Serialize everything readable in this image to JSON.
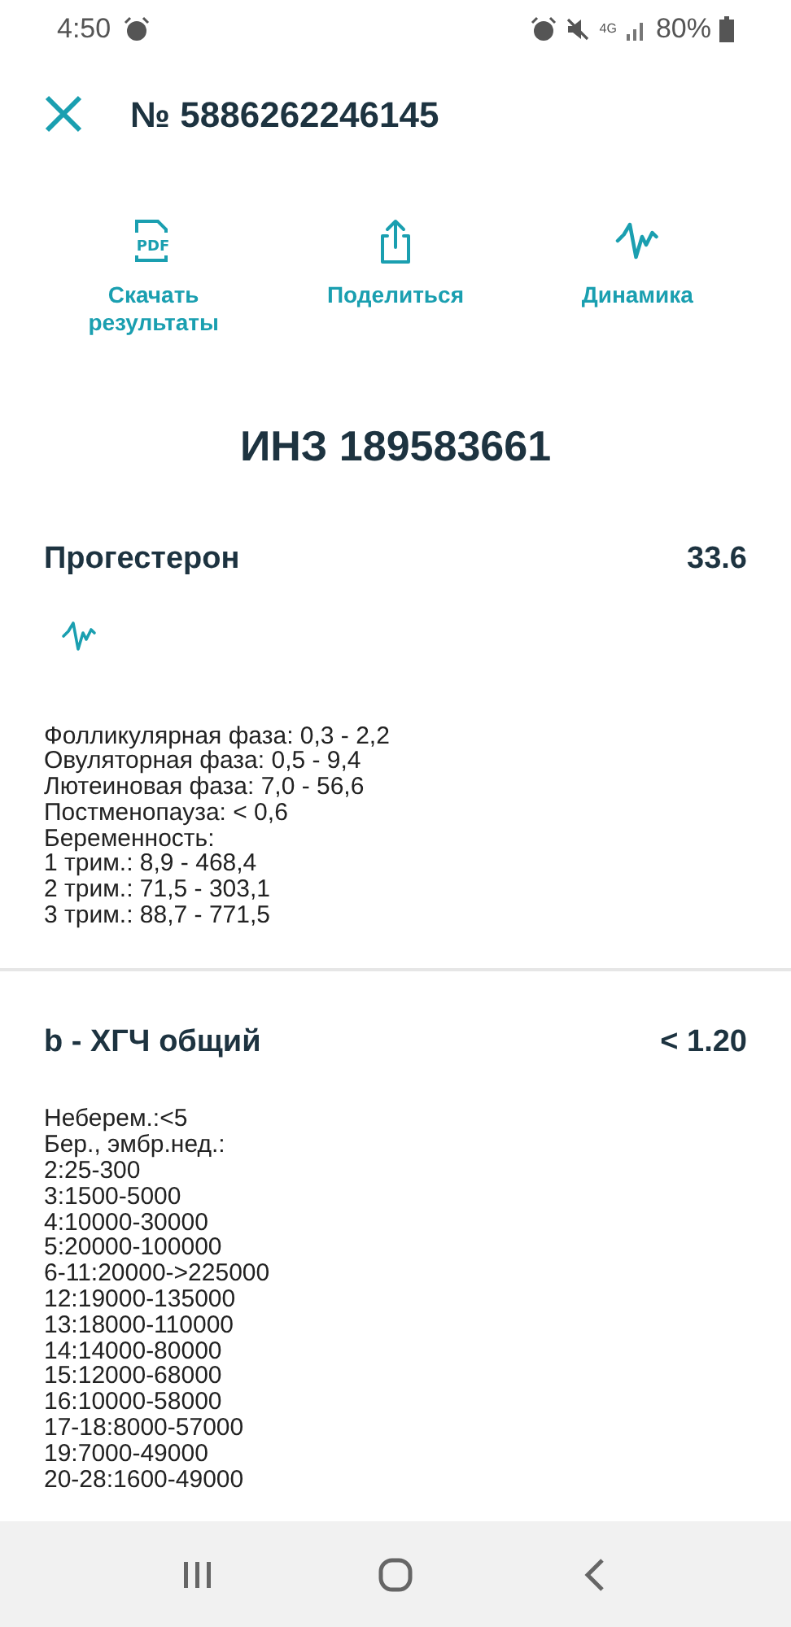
{
  "status_bar": {
    "time": "4:50",
    "network": "4G",
    "battery": "80%"
  },
  "header": {
    "title": "№ 5886262246145"
  },
  "actions": [
    {
      "kind": "pdf",
      "icon_text": "PDF",
      "label": "Скачать результаты"
    },
    {
      "kind": "share",
      "label": "Поделиться"
    },
    {
      "kind": "trend",
      "label": "Динамика"
    }
  ],
  "order_id": "ИНЗ 189583661",
  "tests": [
    {
      "name": "Прогестерон",
      "value": "33.6",
      "trend_button": true,
      "reference": [
        "Фолликулярная фаза: 0,3 - 2,2",
        "Овуляторная фаза: 0,5 - 9,4",
        "Лютеиновая фаза: 7,0 - 56,6",
        "Постменопауза: < 0,6",
        "Беременность:",
        "1 трим.: 8,9 - 468,4",
        "2 трим.: 71,5 - 303,1",
        "3 трим.: 88,7 - 771,5"
      ]
    },
    {
      "name": "b - ХГЧ общий",
      "value": "< 1.20",
      "trend_button": false,
      "reference": [
        "Неберем.:<5",
        "Бер., эмбр.нед.:",
        "2:25-300",
        "3:1500-5000",
        "4:10000-30000",
        "5:20000-100000",
        "6-11:20000->225000",
        "12:19000-135000",
        "13:18000-110000",
        "14:14000-80000",
        "15:12000-68000",
        "16:10000-58000",
        "17-18:8000-57000",
        "19:7000-49000",
        "20-28:1600-49000"
      ]
    }
  ]
}
